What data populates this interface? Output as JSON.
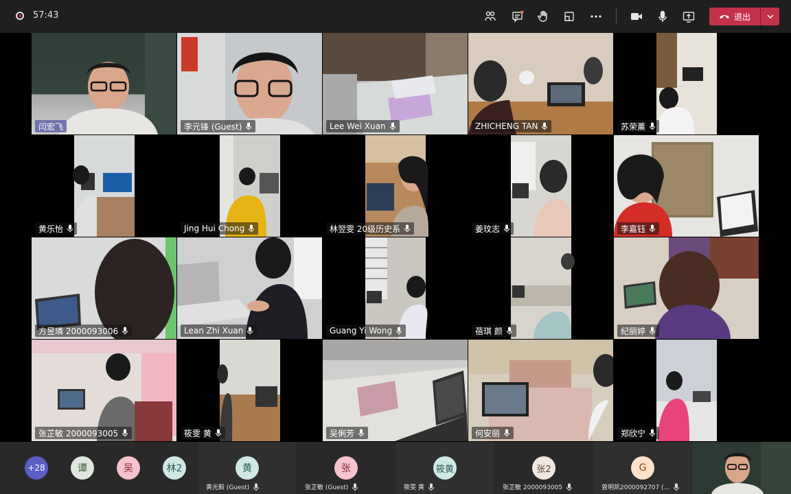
{
  "meeting": {
    "timer": "57:43",
    "leave_label": "退出"
  },
  "toolbar": {
    "icons": [
      "participants-icon",
      "chat-icon",
      "raise-hand-icon",
      "share-tray-icon",
      "more-icon",
      "camera-icon",
      "microphone-icon",
      "share-screen-icon"
    ]
  },
  "tiles": [
    {
      "name": "闫宏飞",
      "mic": false,
      "speaking": true
    },
    {
      "name": "李元锋 (Guest)",
      "mic": true
    },
    {
      "name": "Lee Wei Xuan",
      "mic": true
    },
    {
      "name": "ZHICHENG TAN",
      "mic": true
    },
    {
      "name": "苏荣薰",
      "mic": true
    },
    {
      "name": "黄乐怡",
      "mic": true
    },
    {
      "name": "Jing Hui Chong",
      "mic": true
    },
    {
      "name": "林翌雯 20级历史系",
      "mic": true
    },
    {
      "name": "姜玟志",
      "mic": true
    },
    {
      "name": "李嘉钰",
      "mic": true
    },
    {
      "name": "方昱璘 2000093006",
      "mic": true
    },
    {
      "name": "Lean Zhi Xuan",
      "mic": true
    },
    {
      "name": "Guang Yi Wong",
      "mic": true
    },
    {
      "name": "蓓琪 颜",
      "mic": true
    },
    {
      "name": "纪丽婷",
      "mic": true
    },
    {
      "name": "张芷敏 2000093005",
      "mic": true
    },
    {
      "name": "筱雯 黄",
      "mic": true
    },
    {
      "name": "吴俐芳",
      "mic": true
    },
    {
      "name": "何安丽",
      "mic": true
    },
    {
      "name": "郑欣宁",
      "mic": true
    }
  ],
  "overflow": {
    "more_count": "+28",
    "avatars": [
      {
        "initials": "谭",
        "color": "#dfe6df"
      },
      {
        "initials": "吴",
        "color": "#f5c2cd"
      },
      {
        "initials": "林2",
        "color": "#cfe8e4"
      }
    ]
  },
  "bottom_participants": [
    {
      "initials": "黄",
      "color": "#cfe8e4",
      "name": "黄光毅 (Guest)"
    },
    {
      "initials": "张",
      "color": "#f5c2cd",
      "name": "张芷敏 (Guest)"
    },
    {
      "initials": "筱黄",
      "color": "#cfe8e4",
      "name": "筱雯 黄"
    },
    {
      "initials": "张2",
      "color": "#f0e8e0",
      "name": "张芷敏 2000093005"
    },
    {
      "initials": "G",
      "color": "#fde1c8",
      "name": "曾明凯2000092707 (..."
    }
  ],
  "colors": {
    "topbar": "#1f1f1f",
    "leave": "#c4314b",
    "more_badge": "#5b5fc7",
    "active_speaker": "#6264a7"
  }
}
